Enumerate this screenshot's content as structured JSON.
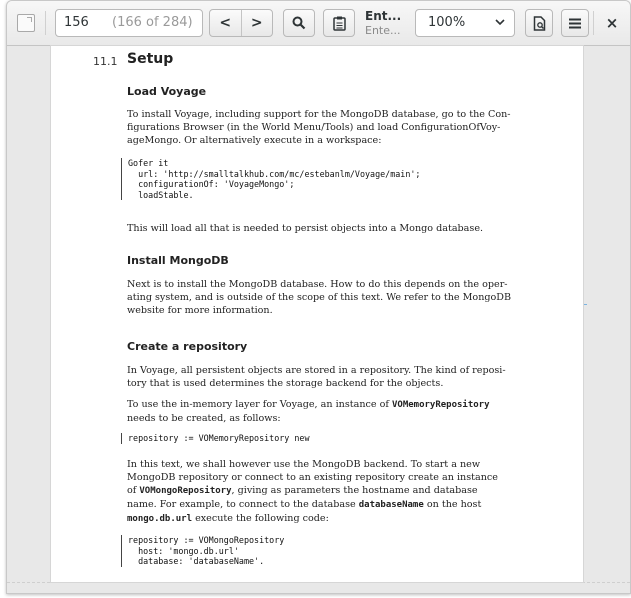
{
  "toolbar": {
    "page_number": "156",
    "page_of": "(166 of 284)",
    "prev_glyph": "<",
    "next_glyph": ">",
    "title_main": "Ent...",
    "title_sub": "Ente...",
    "zoom": "100%",
    "close_glyph": "×"
  },
  "document": {
    "section_number": "11.1",
    "section_title": "Setup",
    "load_voyage": {
      "heading": "Load Voyage",
      "lines": [
        "To install Voyage, including support for the MongoDB database, go to the Con-",
        "figurations Browser (in the World Menu/Tools) and load ConfigurationOfVoy-",
        "ageMongo. Or alternatively execute in a workspace:"
      ],
      "code": [
        "Gofer it",
        "  url: 'http://smalltalkhub.com/mc/estebanlm/Voyage/main';",
        "  configurationOf: 'VoyageMongo';",
        "  loadStable."
      ],
      "after": "This will load all that is needed to persist objects into a Mongo database."
    },
    "install_mongodb": {
      "heading": "Install MongoDB",
      "lines": [
        "Next is to install the MongoDB database. How to do this depends on the oper-",
        "ating system, and is outside of the scope of this text. We refer to the MongoDB",
        "website for more information."
      ]
    },
    "create_repository": {
      "heading": "Create a repository",
      "p1": [
        "In Voyage, all persistent objects are stored in a repository. The kind of reposi-",
        "tory that is used determines the storage backend for the objects."
      ],
      "p2_a": "To use the in-memory layer for Voyage, an instance of ",
      "p2_code": "VOMemoryRepository",
      "p2_b": "needs to be created, as follows:",
      "code1": "repository := VOMemoryRepository new",
      "p3_l1": "In this text, we shall however use the MongoDB backend. To start a new",
      "p3_l2": "MongoDB repository or connect to an existing repository create an instance",
      "p3_l3_a": "of ",
      "p3_l3_code": "VOMongoRepository",
      "p3_l3_b": ", giving as parameters the hostname and database",
      "p3_l4_a": "name. For example, to connect to the database ",
      "p3_l4_code": "databaseName",
      "p3_l4_b": " on the host",
      "p3_l5_code": "mongo.db.url",
      "p3_l5_b": " execute the following code:",
      "code2": [
        "repository := VOMongoRepository",
        "  host: 'mongo.db.url'",
        "  database: 'databaseName'."
      ]
    }
  }
}
